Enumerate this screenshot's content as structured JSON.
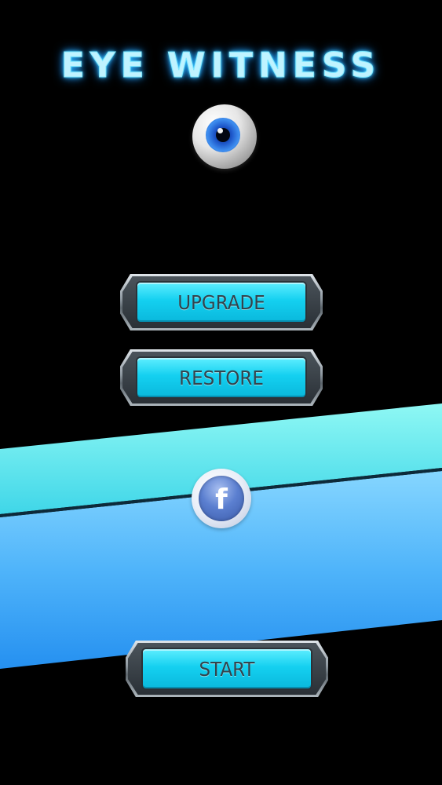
{
  "title": "EYE WITNESS",
  "buttons": {
    "upgrade": "UPGRADE",
    "restore": "RESTORE",
    "start": "START"
  },
  "social": {
    "facebook_glyph": "f",
    "icon": "facebook-icon"
  },
  "colors": {
    "background": "#000000",
    "title_glow": "#4fd6ff",
    "button_face": "#14d0f0",
    "button_text": "#34434c",
    "band_top": "#6cf0f0",
    "band_bottom": "#2a9ef0"
  }
}
